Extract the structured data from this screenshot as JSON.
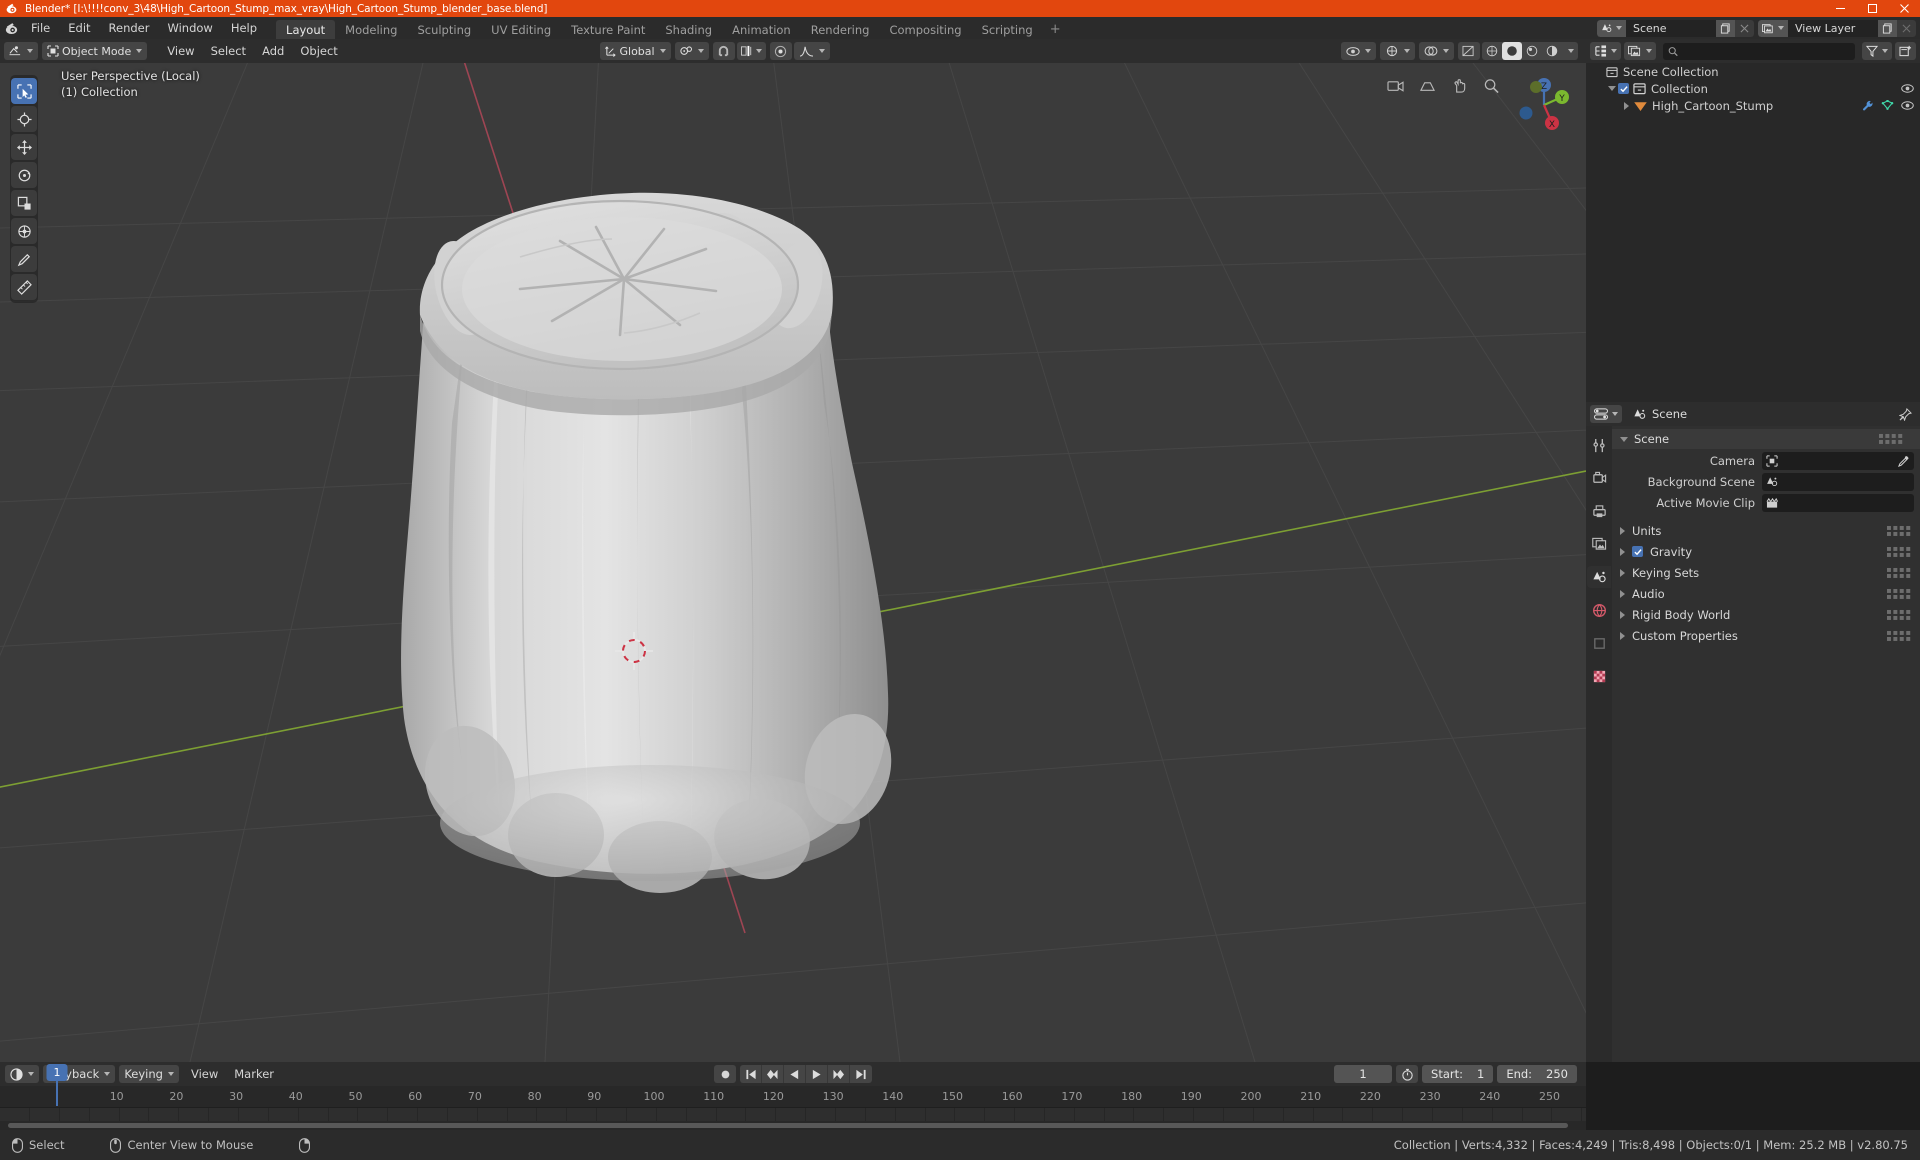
{
  "window": {
    "title": "Blender* [I:\\!!!!conv_3\\48\\High_Cartoon_Stump_max_vray\\High_Cartoon_Stump_blender_base.blend]",
    "icon": "blender-icon",
    "minimize": "minimize-icon",
    "maximize": "maximize-icon",
    "close": "close-icon"
  },
  "topbar": {
    "menus": [
      "File",
      "Edit",
      "Render",
      "Window",
      "Help"
    ],
    "workspaces": [
      {
        "label": "Layout",
        "active": true
      },
      {
        "label": "Modeling",
        "active": false
      },
      {
        "label": "Sculpting",
        "active": false
      },
      {
        "label": "UV Editing",
        "active": false
      },
      {
        "label": "Texture Paint",
        "active": false
      },
      {
        "label": "Shading",
        "active": false
      },
      {
        "label": "Animation",
        "active": false
      },
      {
        "label": "Rendering",
        "active": false
      },
      {
        "label": "Compositing",
        "active": false
      },
      {
        "label": "Scripting",
        "active": false
      }
    ],
    "add_workspace": "+",
    "scene": {
      "name": "Scene",
      "new_label": "new-scene-icon",
      "remove_label": "x"
    },
    "view_layer": {
      "name": "View Layer",
      "new_label": "new-viewlayer-icon",
      "remove_label": "x"
    }
  },
  "viewport_header": {
    "editor_type": "3d-viewport-icon",
    "mode": "Object Mode",
    "menus": [
      "View",
      "Select",
      "Add",
      "Object"
    ],
    "transform_orientation": "Global",
    "snap": "snap-magnet-icon",
    "proportional_edit": "proportional-editing-icon",
    "falloff": "smooth-falloff-icon",
    "shading_modes": [
      "wireframe",
      "solid",
      "material-preview",
      "rendered"
    ],
    "active_shading": "solid"
  },
  "viewport": {
    "perspective_text": "User Perspective (Local)",
    "collection_text": "(1) Collection",
    "tools": [
      {
        "name": "select-box-tool",
        "active": true
      },
      {
        "name": "cursor-tool",
        "active": false
      },
      {
        "name": "move-tool",
        "active": false
      },
      {
        "name": "rotate-tool",
        "active": false
      },
      {
        "name": "scale-tool",
        "active": false
      },
      {
        "name": "transform-tool",
        "active": false
      },
      {
        "name": "annotate-tool",
        "active": false
      },
      {
        "name": "measure-tool",
        "active": false
      }
    ],
    "gizmo_axes": {
      "x": "X",
      "y": "Y",
      "z": "Z"
    },
    "nav_buttons": [
      "toggle-camera-icon",
      "toggle-perspective-icon",
      "move-view-icon",
      "zoom-view-icon"
    ],
    "background_color": "#3b3b3b",
    "grid_color": "#4a4a4a",
    "axis_x_color": "#cc5166",
    "axis_y_color": "#8fbf3f",
    "object_color": "#c9c9c9"
  },
  "outliner": {
    "display_mode": "view-layer-icon",
    "filter_icon": "filter-icon",
    "new_collection_icon": "new-collection-icon",
    "search_placeholder": "",
    "rows": [
      {
        "label": "Scene Collection",
        "icon": "collection-icon",
        "depth": 0,
        "expander": "none",
        "checkbox": false,
        "eye": true
      },
      {
        "label": "Collection",
        "icon": "collection-icon",
        "depth": 1,
        "expander": "down",
        "checkbox": true,
        "eye": true
      },
      {
        "label": "High_Cartoon_Stump",
        "icon": "mesh-object-icon",
        "depth": 2,
        "expander": "right",
        "checkbox": false,
        "eye": true,
        "extra_icons": [
          "modifier-wrench-icon",
          "mesh-data-icon"
        ]
      }
    ]
  },
  "properties": {
    "editor_icon": "properties-editor-icon",
    "breadcrumb": "Scene",
    "breadcrumb_icon": "scene-icon",
    "pin_icon": "pin-icon",
    "tabs": [
      {
        "name": "tool-tab",
        "icon": "tool-icon",
        "active": false
      },
      {
        "name": "render-tab",
        "icon": "render-camera-icon",
        "active": false
      },
      {
        "name": "output-tab",
        "icon": "output-printer-icon",
        "active": false
      },
      {
        "name": "view-layer-tab",
        "icon": "view-layer-images-icon",
        "active": false
      },
      {
        "name": "scene-tab",
        "icon": "scene-cone-icon",
        "active": true
      },
      {
        "name": "world-tab",
        "icon": "world-globe-icon",
        "active": false
      },
      {
        "name": "object-tab",
        "icon": "object-square-icon",
        "active": false
      },
      {
        "name": "texture-tab",
        "icon": "texture-checker-icon",
        "active": false
      }
    ],
    "panel_title": "Scene",
    "fields": [
      {
        "label": "Camera",
        "value": "",
        "icon": "camera-field-icon",
        "eyedropper": true
      },
      {
        "label": "Background Scene",
        "value": "",
        "icon": "scene-field-icon",
        "eyedropper": false
      },
      {
        "label": "Active Movie Clip",
        "value": "",
        "icon": "movieclip-field-icon",
        "eyedropper": false
      }
    ],
    "sections": [
      {
        "label": "Units",
        "checkbox": null
      },
      {
        "label": "Gravity",
        "checkbox": true
      },
      {
        "label": "Keying Sets",
        "checkbox": null
      },
      {
        "label": "Audio",
        "checkbox": null
      },
      {
        "label": "Rigid Body World",
        "checkbox": null
      },
      {
        "label": "Custom Properties",
        "checkbox": null
      }
    ]
  },
  "timeline": {
    "editor_icon": "timeline-editor-icon",
    "menus": [
      {
        "label": "Playback",
        "dropdown": true
      },
      {
        "label": "Keying",
        "dropdown": true
      },
      {
        "label": "View",
        "dropdown": false
      },
      {
        "label": "Marker",
        "dropdown": false
      }
    ],
    "playback_buttons": [
      "record-icon",
      "jump-start-icon",
      "prev-keyframe-icon",
      "play-reverse-icon",
      "play-icon",
      "next-keyframe-icon",
      "jump-end-icon"
    ],
    "current_frame": "1",
    "use_preview_range_icon": "stopwatch-icon",
    "start_label": "Start:",
    "start_value": "1",
    "end_label": "End:",
    "end_value": "250",
    "ruler_ticks": [
      "10",
      "20",
      "30",
      "40",
      "50",
      "60",
      "70",
      "80",
      "90",
      "100",
      "110",
      "120",
      "130",
      "140",
      "150",
      "160",
      "170",
      "180",
      "190",
      "200",
      "210",
      "220",
      "230",
      "240",
      "250"
    ],
    "playhead_frame": "1",
    "playhead_color": "#4772b3"
  },
  "statusbar": {
    "hints": [
      {
        "icon": "mouse-left-icon",
        "label": "Select"
      },
      {
        "icon": "mouse-middle-icon",
        "label": "Center View to Mouse"
      },
      {
        "icon": "mouse-right-icon",
        "label": ""
      }
    ],
    "stats": "Collection | Verts:4,332 | Faces:4,249 | Tris:8,498 | Objects:0/1 | Mem: 25.2 MB | v2.80.75"
  }
}
